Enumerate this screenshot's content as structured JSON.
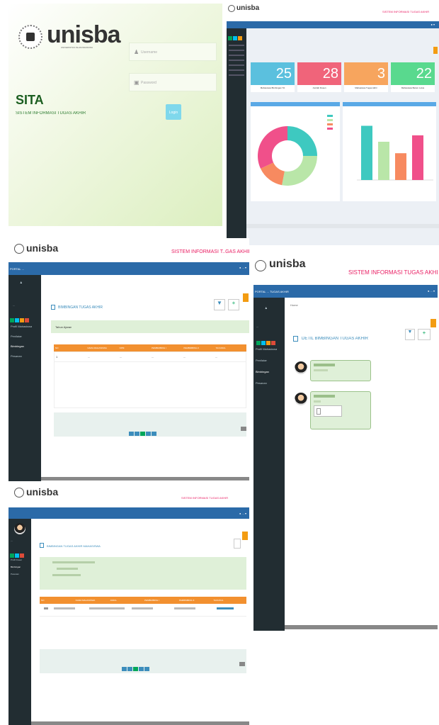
{
  "login": {
    "logo_text": "unisba",
    "logo_sub": "UNIVERSITAS ISLAM BANDUNG",
    "app_name": "SITA",
    "app_full": "SISTEM INFORMASI TUGAS AKHIR",
    "username_placeholder": "Username",
    "password_placeholder": "Password",
    "login_button": "Login"
  },
  "dashboard": {
    "logo_text": "unisba",
    "header_title": "SISTEM INFORMASI TUGAS AKHIR",
    "cards": [
      {
        "value": "25",
        "label": "Mahasiswa Bimbingan TA",
        "color": "#5bc0de"
      },
      {
        "value": "28",
        "label": "Jumlah Dosen",
        "color": "#f0647a"
      },
      {
        "value": "3",
        "label": "Mahasiswa Tugas Akhir",
        "color": "#f7a55e"
      },
      {
        "value": "22",
        "label": "Mahasiswa Belum Lulus",
        "color": "#59d98e"
      }
    ],
    "donut_segments": [
      {
        "value": 25,
        "color": "#3ec9c0"
      },
      {
        "value": 28,
        "color": "#b9e6a8"
      },
      {
        "value": 15,
        "color": "#f78a60"
      },
      {
        "value": 32,
        "color": "#f0508a"
      }
    ],
    "legend_colors": [
      "#3ec9c0",
      "#b9e6a8",
      "#f78a60",
      "#f0508a"
    ],
    "bars": [
      {
        "value": 0.85,
        "color": "#3ec9c0"
      },
      {
        "value": 0.6,
        "color": "#b9e6a8"
      },
      {
        "value": 0.42,
        "color": "#f78a60"
      },
      {
        "value": 0.7,
        "color": "#f0508a"
      }
    ]
  },
  "list_page": {
    "logo_text": "unisba",
    "header_title": "SISTEM INFORMASI T..GAS AKHIR",
    "portal_label": "PORTAL ...",
    "page_title": "BIMBINGAN TUGAS AKHIR",
    "filter_label": "Tahun Ajaran",
    "sidebar_items": [
      "Profil Mahasiswa",
      "Penilaian",
      "Bimbingan",
      "Pesanan"
    ],
    "columns": [
      "NO",
      "NAMA MAHASISWA",
      "NPM",
      "PEMBIMBING I",
      "PEMBIMBING II",
      "TA/JUDUL"
    ],
    "rows": [
      [
        "1",
        "...",
        "...",
        "...",
        "...",
        "..."
      ]
    ]
  },
  "chat_page": {
    "logo_text": "unisba",
    "header_title": "SISTEM INFORMASI TUGAS AKHIR",
    "portal_label": "PORTAL ... TUGAS AKHIR",
    "page_title": "DETIL BIMBINGAN TUGAS AKHIR",
    "sidebar_items": [
      "Profil Mahasiswa",
      "Penilaian",
      "Bimbingan",
      "Pesanan"
    ],
    "home_label": "Home"
  },
  "detail_page": {
    "logo_text": "unisba",
    "header_title": "SISTEM INFORMASI TUGAS AKHIR",
    "page_title": "BIMBINGAN TUGAS AKHIR MAHASISWA",
    "columns": [
      "NO",
      "NAMA MAHASISWA",
      "JUDUL",
      "PEMBIMBING I",
      "PEMBIMBING II",
      "TA/JUDUL"
    ],
    "sidebar_items": [
      "Profil Dosen",
      "Bimbingan",
      "Pesanan"
    ]
  }
}
